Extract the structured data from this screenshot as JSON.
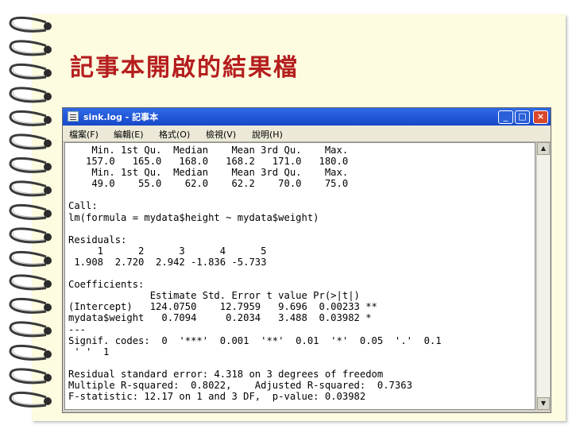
{
  "slide": {
    "title": "記事本開啟的結果檔"
  },
  "window": {
    "title": "sink.log - 記事本",
    "buttons": {
      "minimize": "_",
      "maximize": "□",
      "close": "×"
    }
  },
  "menu": [
    {
      "label": "檔案(F)"
    },
    {
      "label": "編輯(E)"
    },
    {
      "label": "格式(O)"
    },
    {
      "label": "檢視(V)"
    },
    {
      "label": "說明(H)"
    }
  ],
  "editor": {
    "lines": [
      "    Min. 1st Qu.  Median    Mean 3rd Qu.    Max.",
      "   157.0   165.0   168.0   168.2   171.0   180.0",
      "    Min. 1st Qu.  Median    Mean 3rd Qu.    Max.",
      "    49.0    55.0    62.0    62.2    70.0    75.0",
      "",
      "Call:",
      "lm(formula = mydata$height ~ mydata$weight)",
      "",
      "Residuals:",
      "     1      2      3      4      5",
      " 1.908  2.720  2.942 -1.836 -5.733",
      "",
      "Coefficients:",
      "              Estimate Std. Error t value Pr(>|t|)",
      "(Intercept)   124.0750    12.7959   9.696  0.00233 **",
      "mydata$weight   0.7094     0.2034   3.488  0.03982 *",
      "---",
      "Signif. codes:  0  '***'  0.001  '**'  0.01  '*'  0.05  '.'  0.1",
      " ' '  1",
      "",
      "Residual standard error: 4.318 on 3 degrees of freedom",
      "Multiple R-squared:  0.8022,    Adjusted R-squared:  0.7363",
      "F-statistic: 12.17 on 1 and 3 DF,  p-value: 0.03982"
    ]
  },
  "scrollbar": {
    "up": "▲",
    "down": "▼"
  },
  "colors": {
    "title": "#b51e1e",
    "page": "#fdfbe0",
    "titlebar": "#1748c8",
    "close": "#d9472b"
  },
  "icons": {
    "app": "notepad-icon",
    "binding": "spiral-ring-icon"
  }
}
